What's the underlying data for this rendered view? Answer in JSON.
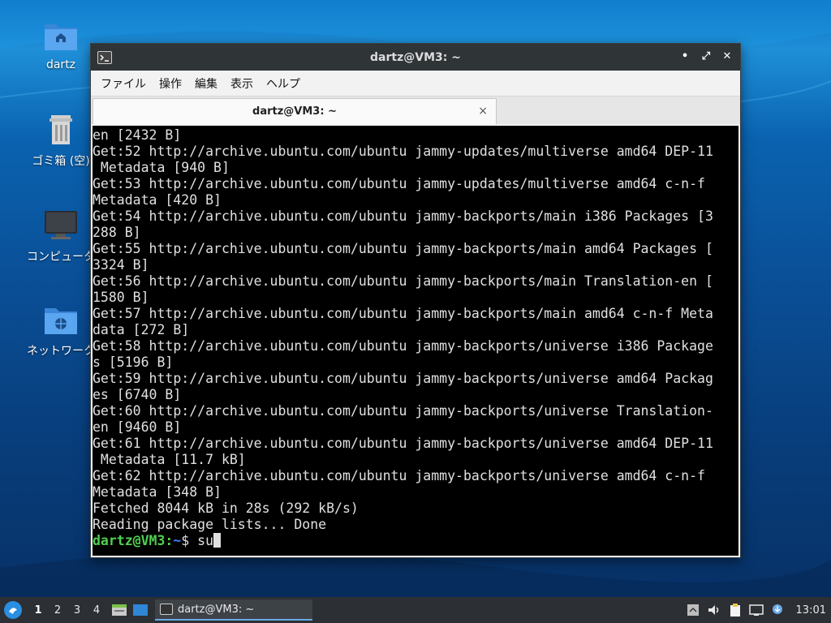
{
  "desktop": {
    "icons": [
      {
        "label": "dartz",
        "icon": "home-folder-icon"
      },
      {
        "label": "ゴミ箱 (空)",
        "icon": "trash-icon"
      },
      {
        "label": "コンピュータ",
        "icon": "computer-icon"
      },
      {
        "label": "ネットワーク",
        "icon": "network-folder-icon"
      }
    ]
  },
  "window": {
    "title": "dartz@VM3: ~",
    "menu": [
      "ファイル",
      "操作",
      "編集",
      "表示",
      "ヘルプ"
    ],
    "tab_label": "dartz@VM3: ~",
    "tab_close": "×",
    "controls": {
      "minimize": "•",
      "maximize": "⤢",
      "close": "✕"
    }
  },
  "terminal": {
    "lines": [
      "en [2432 B]",
      "Get:52 http://archive.ubuntu.com/ubuntu jammy-updates/multiverse amd64 DEP-11",
      " Metadata [940 B]",
      "Get:53 http://archive.ubuntu.com/ubuntu jammy-updates/multiverse amd64 c-n-f",
      "Metadata [420 B]",
      "Get:54 http://archive.ubuntu.com/ubuntu jammy-backports/main i386 Packages [3",
      "288 B]",
      "Get:55 http://archive.ubuntu.com/ubuntu jammy-backports/main amd64 Packages [",
      "3324 B]",
      "Get:56 http://archive.ubuntu.com/ubuntu jammy-backports/main Translation-en [",
      "1580 B]",
      "Get:57 http://archive.ubuntu.com/ubuntu jammy-backports/main amd64 c-n-f Meta",
      "data [272 B]",
      "Get:58 http://archive.ubuntu.com/ubuntu jammy-backports/universe i386 Package",
      "s [5196 B]",
      "Get:59 http://archive.ubuntu.com/ubuntu jammy-backports/universe amd64 Packag",
      "es [6740 B]",
      "Get:60 http://archive.ubuntu.com/ubuntu jammy-backports/universe Translation-",
      "en [9460 B]",
      "Get:61 http://archive.ubuntu.com/ubuntu jammy-backports/universe amd64 DEP-11",
      " Metadata [11.7 kB]",
      "Get:62 http://archive.ubuntu.com/ubuntu jammy-backports/universe amd64 c-n-f",
      "Metadata [348 B]",
      "Fetched 8044 kB in 28s (292 kB/s)",
      "Reading package lists... Done"
    ],
    "prompt_user": "dartz@VM3",
    "prompt_colon": ":",
    "prompt_path": "~",
    "prompt_symbol": "$ ",
    "command": "su"
  },
  "taskbar": {
    "workspaces": [
      "1",
      "2",
      "3",
      "4"
    ],
    "active_workspace": "1",
    "task_label": "dartz@VM3: ~",
    "clock": "13:01"
  },
  "colors": {
    "prompt_user": "#4fd04f",
    "prompt_path": "#3b82f6",
    "titlebar": "#2f3437",
    "taskbar": "#2c2f33"
  }
}
